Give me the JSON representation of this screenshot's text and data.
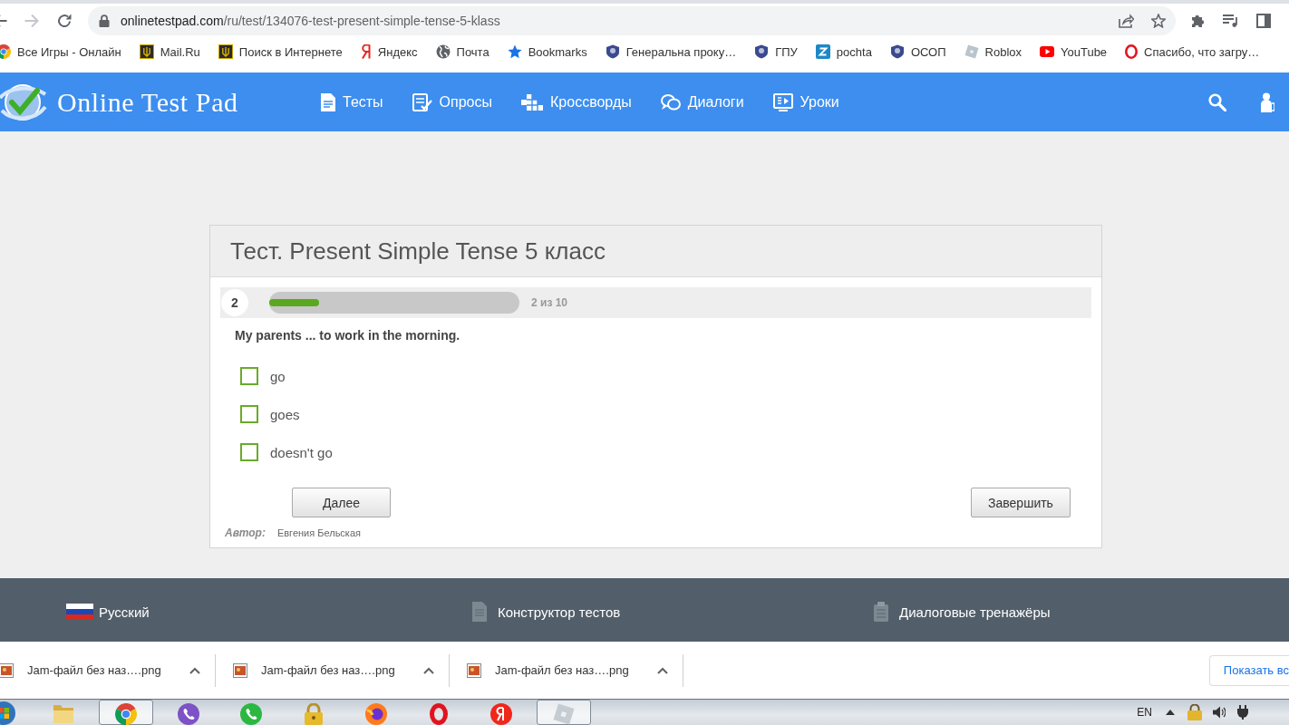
{
  "browser": {
    "url_host": "onlinetestpad.com",
    "url_path": "/ru/test/134076-test-present-simple-tense-5-klass",
    "bookmarks": [
      {
        "label": "Все Игры - Онлайн"
      },
      {
        "label": "Mail.Ru"
      },
      {
        "label": "Поиск в Интернете"
      },
      {
        "label": "Яндекс"
      },
      {
        "label": "Почта"
      },
      {
        "label": "Bookmarks"
      },
      {
        "label": "Генеральна проку…"
      },
      {
        "label": "ГПУ"
      },
      {
        "label": "pochta"
      },
      {
        "label": "ОСОП"
      },
      {
        "label": "Roblox"
      },
      {
        "label": "YouTube"
      },
      {
        "label": "Спасибо, что загру…"
      }
    ]
  },
  "site_header": {
    "logo": "Online Test Pad",
    "nav": [
      {
        "label": "Тесты"
      },
      {
        "label": "Опросы"
      },
      {
        "label": "Кроссворды"
      },
      {
        "label": "Диалоги"
      },
      {
        "label": "Уроки"
      }
    ]
  },
  "test": {
    "title": "Тест. Present Simple Tense 5 класс",
    "question_number": "2",
    "progress": {
      "level": 0.2,
      "reading": "2 из 10"
    },
    "question": "My parents ... to work in the morning.",
    "options": [
      {
        "label": "go",
        "checked": false
      },
      {
        "label": "goes",
        "checked": false
      },
      {
        "label": "doesn't go",
        "checked": false
      }
    ],
    "buttons": [
      "Далее",
      "Завершить"
    ],
    "author_label": "Автор:",
    "author": "Евгения Бельская"
  },
  "footer": {
    "links": [
      {
        "label": "Русский"
      },
      {
        "label": "Конструктор тестов"
      },
      {
        "label": "Диалоговые тренажёры"
      }
    ]
  },
  "downloads": {
    "items": [
      {
        "file": "Jam-файл без наз….png"
      },
      {
        "file": "Jam-файл без наз….png"
      },
      {
        "file": "Jam-файл без наз….png"
      }
    ],
    "show_all": "Показать вс"
  },
  "taskbar": {
    "apps": [
      {
        "running": false
      },
      {
        "running": true
      },
      {
        "running": false
      },
      {
        "running": false
      },
      {
        "running": false
      },
      {
        "running": false
      },
      {
        "running": false
      },
      {
        "running": false
      },
      {
        "running": true
      }
    ],
    "language": "EN"
  }
}
